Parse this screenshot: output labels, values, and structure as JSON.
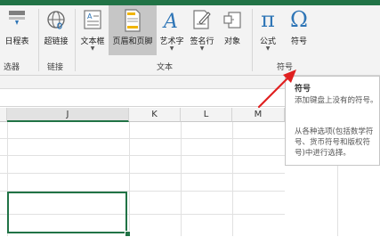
{
  "ribbon": {
    "buttons": [
      {
        "label": "日程表",
        "icon": "timeline-icon"
      },
      {
        "label": "超链接",
        "icon": "hyperlink-globe-icon"
      },
      {
        "label": "文本框",
        "icon": "textbox-icon"
      },
      {
        "label": "页眉和页脚",
        "icon": "header-footer-icon"
      },
      {
        "label": "艺术字",
        "icon": "wordart-icon"
      },
      {
        "label": "签名行",
        "icon": "signature-line-icon"
      },
      {
        "label": "对象",
        "icon": "object-icon"
      },
      {
        "label": "公式",
        "icon": "pi-equation-icon",
        "glyph": "π"
      },
      {
        "label": "符号",
        "icon": "omega-symbol-icon",
        "glyph": "Ω"
      }
    ],
    "groups": {
      "filters": "选器",
      "links": "链接",
      "text": "文本",
      "symbols": "符号"
    }
  },
  "columns": [
    "J",
    "K",
    "L",
    "M"
  ],
  "tooltip": {
    "title": "符号",
    "line1": "添加键盘上没有的符号。",
    "line2": "从各种选项(包括数学符号、货币符号和版权符号)中进行选择。"
  },
  "colors": {
    "accent": "#217346",
    "ribbon_bg": "#f3f3f3",
    "selected_button": "#c6c6c6",
    "icon_blue": "#2e75b6",
    "arrow_red": "#e02020"
  }
}
